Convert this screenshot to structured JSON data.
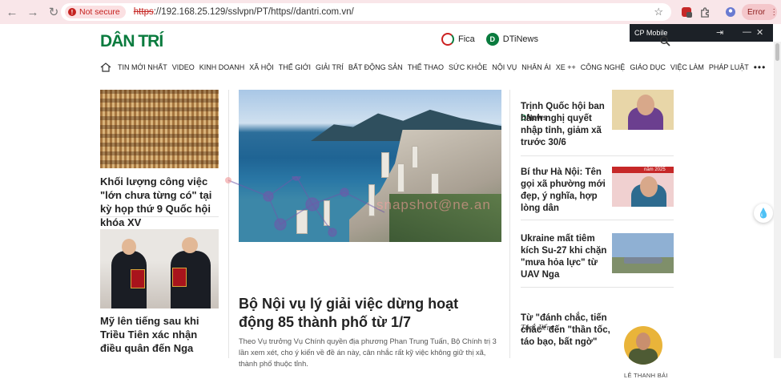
{
  "browser": {
    "security_label": "Not secure",
    "url_scheme": "https",
    "url_rest": "://192.168.25.129/sslvpn/PT/https//dantri.com.vn/",
    "error_label": "Error",
    "extension_badge": "2"
  },
  "cp_popup": {
    "title": "CP Mobile"
  },
  "header": {
    "logo": "DÂN TRÍ",
    "fica": "Fica",
    "dtinews": "DTiNews"
  },
  "menu": [
    "TIN MỚI NHẤT",
    "VIDEO",
    "KINH DOANH",
    "XÃ HỘI",
    "THẾ GIỚI",
    "GIẢI TRÍ",
    "BẤT ĐỘNG SẢN",
    "THỂ THAO",
    "SỨC KHỎE",
    "NỘI VỤ",
    "NHÂN ÁI",
    "XE ++",
    "CÔNG NGHỆ",
    "GIÁO DỤC",
    "VIỆC LÀM",
    "PHÁP LUẬT"
  ],
  "left_articles": [
    {
      "title": "Khối lượng công việc \"lớn chưa từng có\" tại kỳ họp thứ 9 Quốc hội khóa XV"
    },
    {
      "title": "Mỹ lên tiếng sau khi Triều Tiên xác nhận điều quân đến Nga"
    }
  ],
  "main_article": {
    "title": "Bộ Nội vụ lý giải việc dừng hoạt động 85 thành phố từ 1/7",
    "sapo": "Theo Vụ trưởng Vụ Chính quyền địa phương Phan Trung Tuấn, Bộ Chính trị 3 lần xem xét, cho ý kiến về đề án này, cân nhắc rất kỹ việc không giữ thị xã, thành phố thuộc tỉnh."
  },
  "watermark": "snapshot@ne.an",
  "right_section": {
    "dnews_d": "D",
    "dnews_rest": "News",
    "articles": [
      {
        "title": "Trịnh Quốc hội ban hành nghị quyết nhập tỉnh, giảm xã trước 30/6"
      },
      {
        "title": "Bí thư Hà Nội: Tên gọi xã phường mới đẹp, ý nghĩa, hợp lòng dân"
      },
      {
        "title": "Ukraine mất tiêm kích Su-27 khi chặn \"mưa hỏa lực\" từ UAV Nga"
      }
    ],
    "tam_diem": "Tâm điểm",
    "tam_diem_article": "Từ \"đánh chắc, tiến chắc\" đến \"thần tốc, táo bạo, bất ngờ\"",
    "author": "LÊ THANH BẢI",
    "banner_text": "năm 2025"
  }
}
